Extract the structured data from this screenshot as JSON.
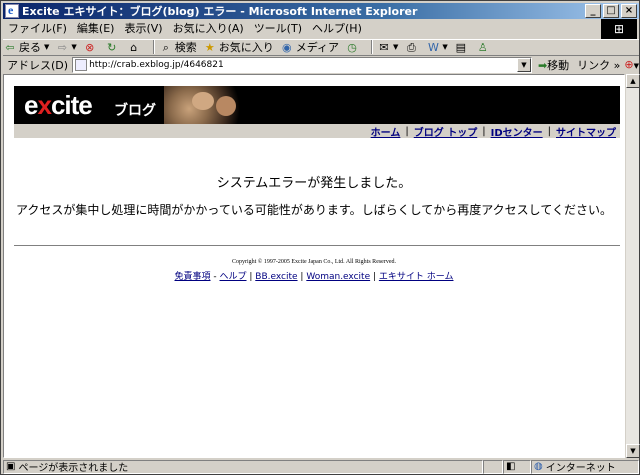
{
  "window": {
    "title": "Excite エキサイト：ブログ(blog) エラー - Microsoft Internet Explorer",
    "controls": [
      "_",
      "□",
      "×"
    ]
  },
  "menu": [
    "ファイル(F)",
    "編集(E)",
    "表示(V)",
    "お気に入り(A)",
    "ツール(T)",
    "ヘルプ(H)"
  ],
  "toolbar": {
    "back": "戻る",
    "search": "検索",
    "favorites": "お気に入り",
    "media": "メディア"
  },
  "address": {
    "label": "アドレス(D)",
    "url": "http://crab.exblog.jp/4646821",
    "go": "移動",
    "links": "リンク"
  },
  "banner": {
    "logo_main": "excite",
    "logo_sub": "ブログ"
  },
  "nav": [
    "ホーム",
    "ブログ トップ",
    "IDセンター",
    "サイトマップ"
  ],
  "error": {
    "title": "システムエラーが発生しました。",
    "message": "アクセスが集中し処理に時間がかかっている可能性があります。しばらくしてから再度アクセスしてください。"
  },
  "footer": {
    "copyright": "Copyright © 1997-2005 Excite Japan Co., Ltd. All Rights Reserved.",
    "links": [
      "免責事項",
      "ヘルプ",
      "BB.excite",
      "Woman.excite",
      "エキサイト ホーム"
    ],
    "sep_first": " - "
  },
  "status": {
    "text": "ページが表示されました",
    "zone": "インターネット"
  }
}
